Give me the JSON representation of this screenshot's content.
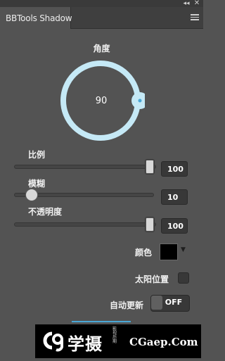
{
  "window": {
    "collapse_glyph": "◂◂",
    "close_glyph": "✕"
  },
  "tab": {
    "title": "BBTools Shadow"
  },
  "angle": {
    "label": "角度",
    "value": "90"
  },
  "scale": {
    "label": "比例",
    "value": "100",
    "level": 1.0
  },
  "blur": {
    "label": "模糊",
    "value": "10",
    "level": 0.1
  },
  "opacity": {
    "label": "不透明度",
    "value": "100",
    "level": 1.0
  },
  "color": {
    "label": "颜色",
    "swatch": "#000000",
    "arrow_glyph": "▼"
  },
  "sun_position": {
    "label": "太阳位置",
    "checked": false
  },
  "auto_update": {
    "label": "自动更新",
    "state": "OFF"
  },
  "watermark": {
    "cn": "学摄",
    "sub": "影视 后期",
    "en": "CGaep.Com"
  },
  "colors": {
    "panel_bg": "#535353",
    "dial_ring": "#c5e9f6",
    "accent": "#4aa7d6"
  }
}
